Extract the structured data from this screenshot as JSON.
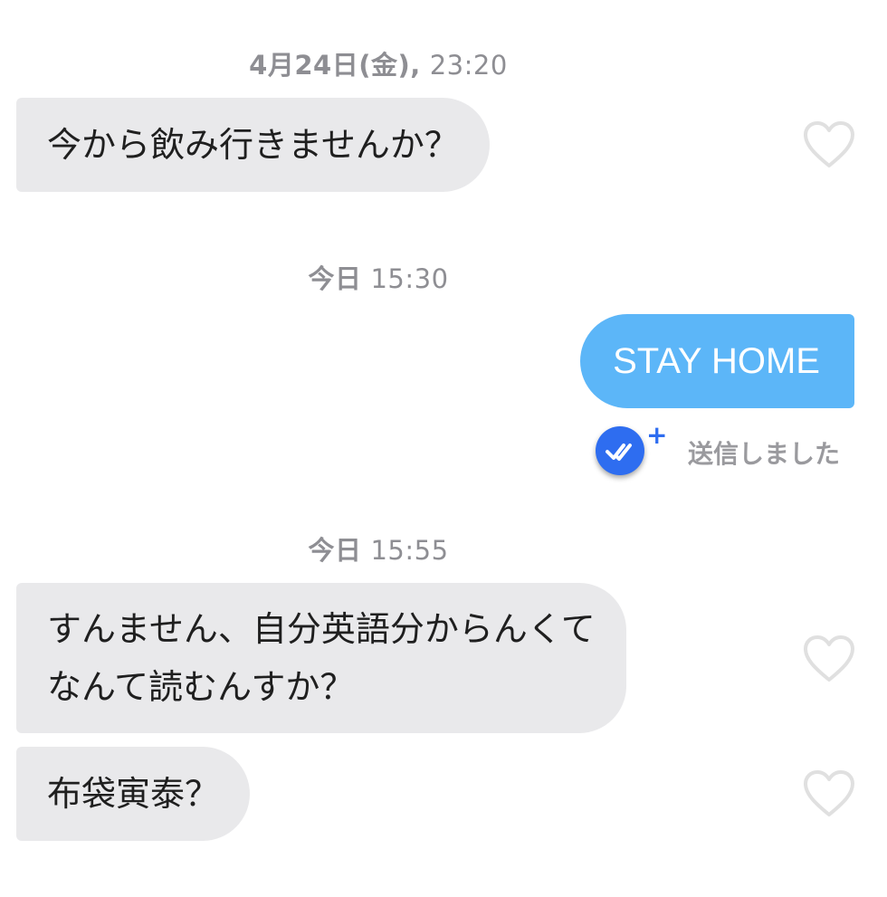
{
  "conversation": {
    "groups": [
      {
        "timestamp_date": "4月24日(金),",
        "timestamp_time": "23:20",
        "messages": [
          {
            "text": "今から飲み行きませんか？"
          }
        ]
      },
      {
        "timestamp_date": "今日",
        "timestamp_time": "15:30",
        "messages": [
          {
            "text": "STAY HOME",
            "receipt": "送信しました"
          }
        ]
      },
      {
        "timestamp_date": "今日",
        "timestamp_time": "15:55",
        "messages": [
          {
            "line1": "すんません、自分英語分からんくて",
            "line2": "なんて読むんすか？"
          },
          {
            "text": "布袋寅泰？"
          }
        ]
      }
    ]
  },
  "colors": {
    "incoming_bubble": "#e9e9eb",
    "outgoing_bubble": "#5cb6f8",
    "read_receipt_accent": "#2e6df0",
    "timestamp_text": "#8e8e93",
    "heart_outline": "#e0e0e0"
  },
  "icons": {
    "like": "heart-outline-icon",
    "read_receipt": "double-check-icon",
    "boost": "plus-icon"
  }
}
